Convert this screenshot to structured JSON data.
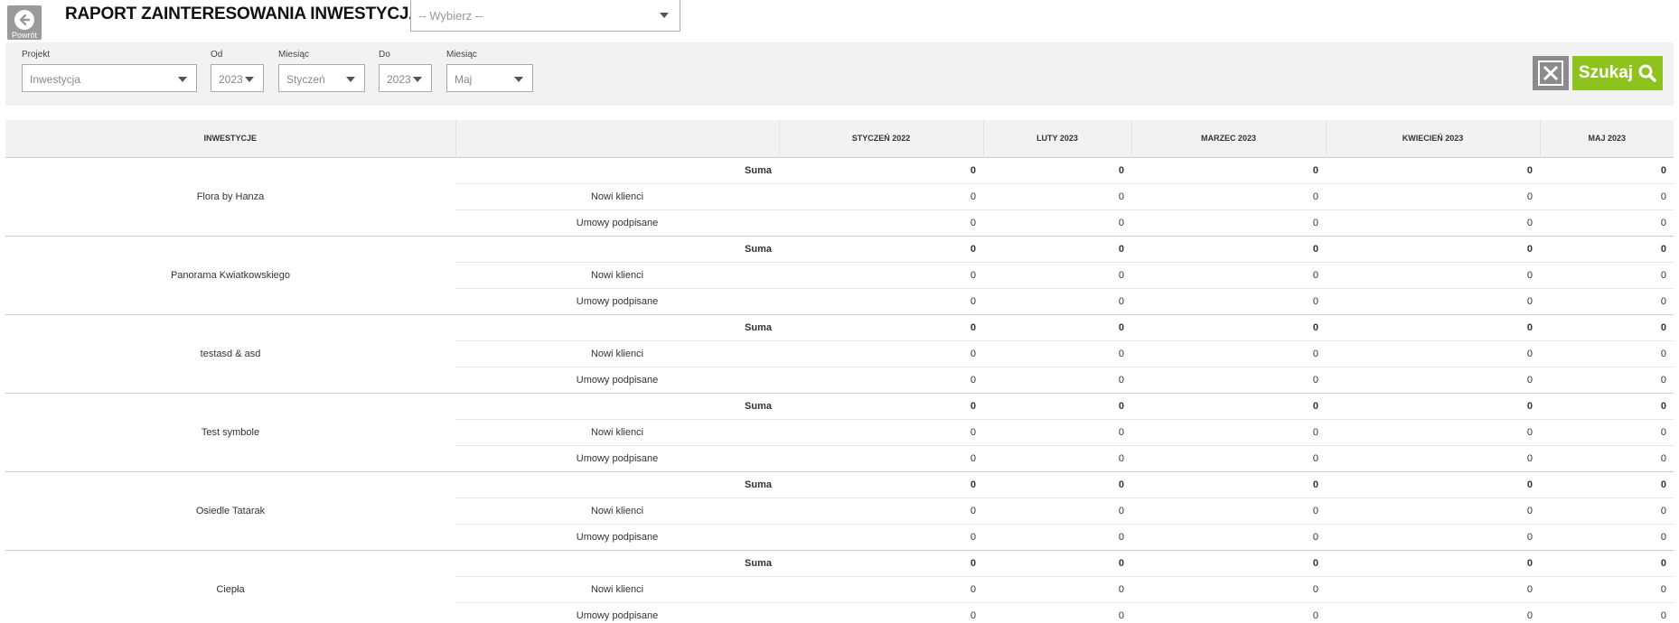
{
  "header": {
    "back_label": "Powrót",
    "title": "RAPORT ZAINTERESOWANIA INWESTYCJĄ",
    "select_placeholder": "-- Wybierz --"
  },
  "filters": {
    "project_label": "Projekt",
    "project_value": "Inwestycja",
    "from_label": "Od",
    "from_year": "2023",
    "from_month_label": "Miesiąc",
    "from_month": "Styczeń",
    "to_label": "Do",
    "to_year": "2023",
    "to_month_label": "Miesiąc",
    "to_month": "Maj",
    "search_label": "Szukaj",
    "excel_icon": "excel-icon"
  },
  "table": {
    "headers": [
      "INWESTYCJE",
      "",
      "STYCZEŃ 2022",
      "LUTY 2023",
      "MARZEC 2023",
      "KWIECIEŃ 2023",
      "MAJ 2023"
    ],
    "metrics": [
      "Suma",
      "Nowi klienci",
      "Umowy podpisane"
    ],
    "groups": [
      {
        "name": "Flora by Hanza",
        "rows": [
          [
            "0",
            "0",
            "0",
            "0",
            "0"
          ],
          [
            "0",
            "0",
            "0",
            "0",
            "0"
          ],
          [
            "0",
            "0",
            "0",
            "0",
            "0"
          ]
        ]
      },
      {
        "name": "Panorama Kwiatkowskiego",
        "rows": [
          [
            "0",
            "0",
            "0",
            "0",
            "0"
          ],
          [
            "0",
            "0",
            "0",
            "0",
            "0"
          ],
          [
            "0",
            "0",
            "0",
            "0",
            "0"
          ]
        ]
      },
      {
        "name": "testasd & asd",
        "rows": [
          [
            "0",
            "0",
            "0",
            "0",
            "0"
          ],
          [
            "0",
            "0",
            "0",
            "0",
            "0"
          ],
          [
            "0",
            "0",
            "0",
            "0",
            "0"
          ]
        ]
      },
      {
        "name": "Test symbole",
        "rows": [
          [
            "0",
            "0",
            "0",
            "0",
            "0"
          ],
          [
            "0",
            "0",
            "0",
            "0",
            "0"
          ],
          [
            "0",
            "0",
            "0",
            "0",
            "0"
          ]
        ]
      },
      {
        "name": "Osiedle Tatarak",
        "rows": [
          [
            "0",
            "0",
            "0",
            "0",
            "0"
          ],
          [
            "0",
            "0",
            "0",
            "0",
            "0"
          ],
          [
            "0",
            "0",
            "0",
            "0",
            "0"
          ]
        ]
      },
      {
        "name": "Ciepła",
        "rows": [
          [
            "0",
            "0",
            "0",
            "0",
            "0"
          ],
          [
            "0",
            "0",
            "0",
            "0",
            "0"
          ],
          [
            "0",
            "0",
            "0",
            "0",
            "0"
          ]
        ]
      }
    ]
  },
  "colors": {
    "search_button": "#8dc21f",
    "excel_button": "#8c8c8c",
    "filter_bar": "#f2f2f2"
  }
}
